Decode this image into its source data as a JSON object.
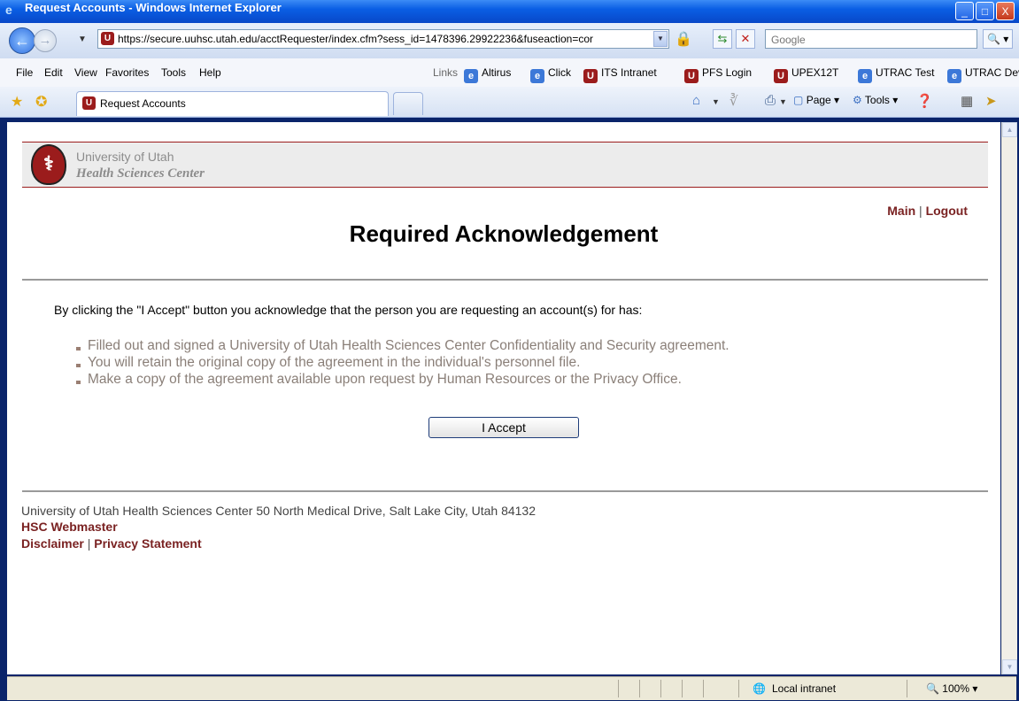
{
  "window": {
    "title": "Request Accounts - Windows Internet Explorer",
    "controls": [
      "_",
      "□",
      "X"
    ]
  },
  "address": {
    "url": "https://secure.uuhsc.utah.edu/acctRequester/index.cfm?sess_id=1478396.29922236&fuseaction=cor"
  },
  "search": {
    "placeholder": "Google"
  },
  "menu": [
    "File",
    "Edit",
    "View",
    "Favorites",
    "Tools",
    "Help"
  ],
  "links_label": "Links",
  "links": [
    "Altirus",
    "Click",
    "ITS Intranet",
    "PFS Login",
    "UPEX12T",
    "UTRAC Test",
    "UTRAC Dev"
  ],
  "tab": {
    "label": "Request Accounts"
  },
  "commands": {
    "page": "Page",
    "tools": "Tools"
  },
  "page": {
    "header": {
      "line1": "University of Utah",
      "line2": "Health Sciences Center"
    },
    "nav": {
      "main": "Main",
      "sep": "|",
      "logout": "Logout"
    },
    "title": "Required Acknowledgement",
    "intro": "By clicking the \"I Accept\" button you acknowledge that the person you are requesting an account(s) for has:",
    "bullets": [
      "Filled out and signed a University of Utah Health Sciences Center Confidentiality and Security agreement.",
      "You will retain the original copy of the agreement in the individual's personnel file.",
      "Make a copy of the agreement available upon request by Human Resources or the Privacy Office."
    ],
    "accept_button": "I Accept",
    "footer": {
      "address": "University of Utah Health Sciences Center  50 North Medical Drive, Salt Lake City, Utah 84132",
      "webmaster": "HSC Webmaster",
      "disclaimer": "Disclaimer",
      "sep": "|",
      "privacy": "Privacy Statement"
    }
  },
  "status": {
    "zone": "Local intranet",
    "zoom": "100%"
  },
  "colors": {
    "accent": "#9b1c1c",
    "link": "#7a2222",
    "bullet_text": "#8a7f78"
  }
}
